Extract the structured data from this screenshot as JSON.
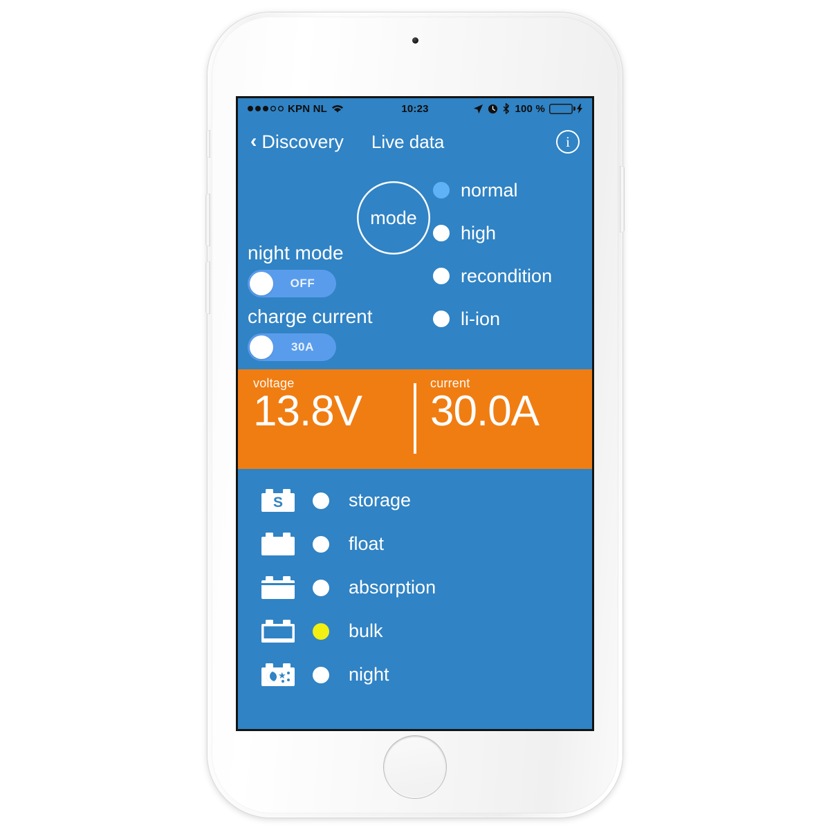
{
  "status_bar": {
    "carrier": "KPN NL",
    "signal_dots_filled": 3,
    "signal_dots_total": 5,
    "wifi_icon": "wifi-icon",
    "time": "10:23",
    "location_icon": "location-arrow-icon",
    "alarm_icon": "alarm-clock-icon",
    "bluetooth_icon": "bluetooth-icon",
    "battery_percent": "100 %",
    "charging_icon": "lightning-bolt-icon",
    "battery_color": "#3fe23f"
  },
  "nav_bar": {
    "back_label": "Discovery",
    "back_chevron": "chevron-left-icon",
    "title": "Live data",
    "info_icon_label": "i"
  },
  "controls": {
    "mode_button_label": "mode",
    "night_mode_label": "night mode",
    "night_mode_value": "OFF",
    "charge_current_label": "charge current",
    "charge_current_value": "30A"
  },
  "mode_options": [
    {
      "label": "normal",
      "active": true
    },
    {
      "label": "high",
      "active": false
    },
    {
      "label": "recondition",
      "active": false
    },
    {
      "label": "li-ion",
      "active": false
    }
  ],
  "readout": {
    "voltage_caption": "voltage",
    "voltage_value": "13.8V",
    "current_caption": "current",
    "current_value": "30.0A"
  },
  "charge_states": [
    {
      "label": "storage",
      "icon": "battery-storage-icon",
      "active": false
    },
    {
      "label": "float",
      "icon": "battery-full-icon",
      "active": false
    },
    {
      "label": "absorption",
      "icon": "battery-absorption-icon",
      "active": false
    },
    {
      "label": "bulk",
      "icon": "battery-bulk-icon",
      "active": true
    },
    {
      "label": "night",
      "icon": "battery-night-icon",
      "active": false
    }
  ],
  "colors": {
    "app_blue": "#3083c4",
    "accent_orange": "#f07d12",
    "toggle_track": "#5a9cec",
    "active_mode_led": "#5fb2f5",
    "active_state_led": "#f2ef12"
  }
}
